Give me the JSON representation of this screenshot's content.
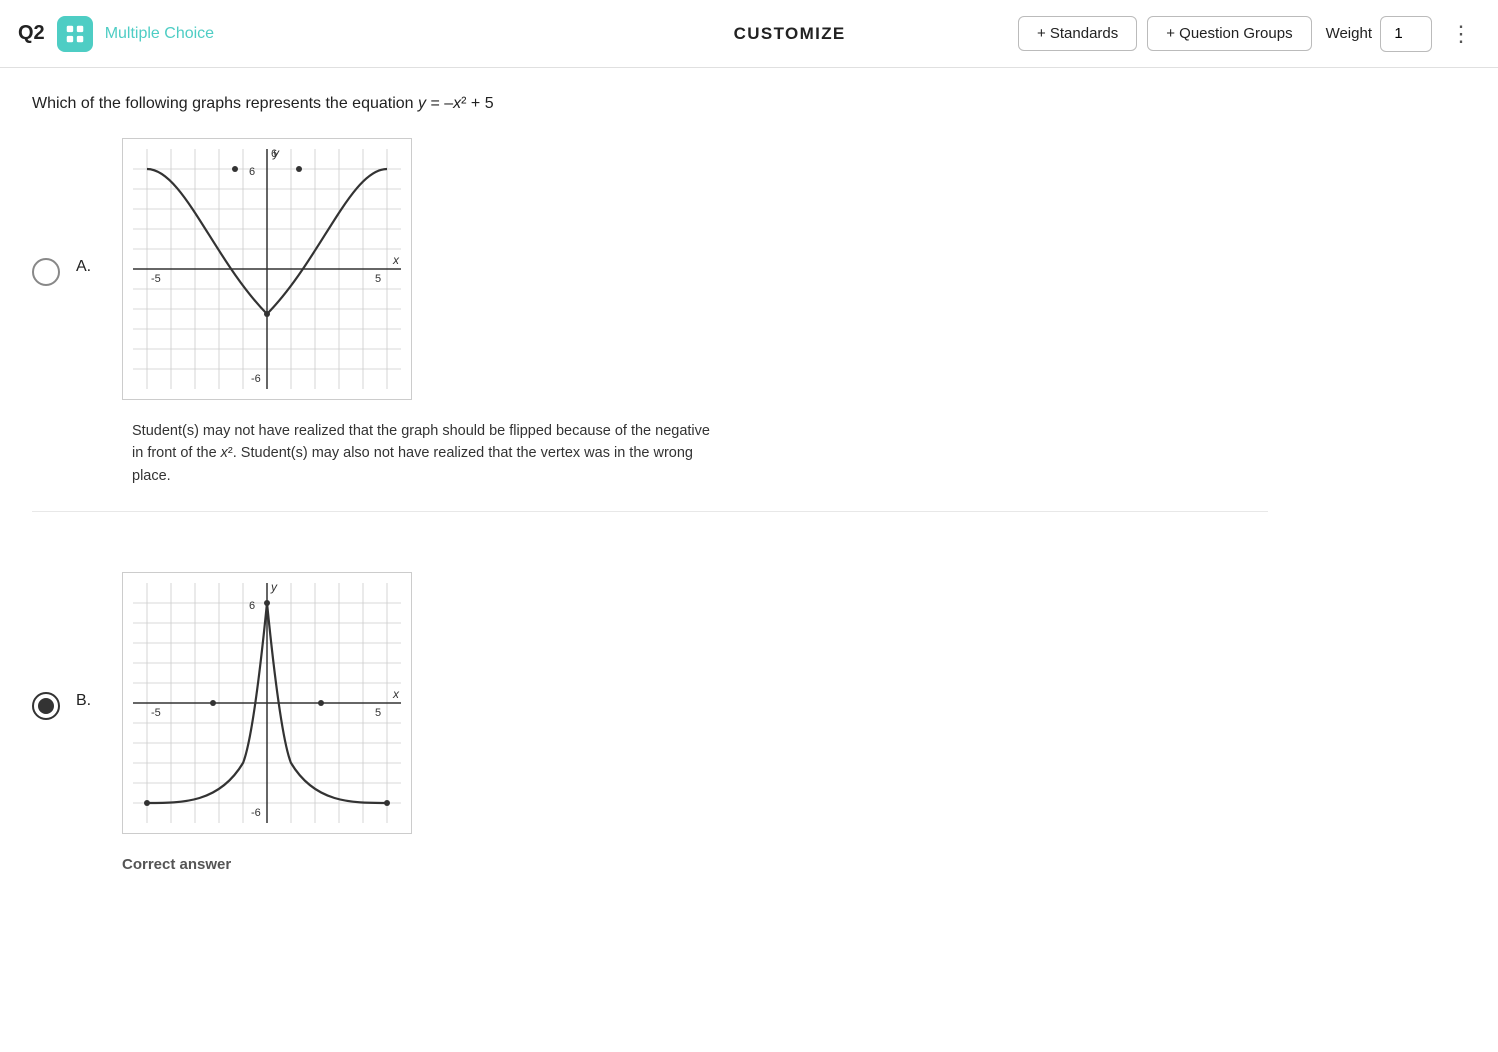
{
  "header": {
    "question_number": "Q2",
    "question_type": "Multiple Choice",
    "customize_label": "CUSTOMIZE",
    "standards_button": "+ Standards",
    "question_groups_button": "+ Question Groups",
    "weight_label": "Weight",
    "weight_value": "1"
  },
  "question": {
    "text": "Which of the following graphs represents the equation y = –x² + 5"
  },
  "answers": [
    {
      "id": "A",
      "label": "A.",
      "selected": false,
      "graph_type": "upward_parabola",
      "explanation": "Student(s) may not have realized that the graph should be flipped because of the negative in front of the x². Student(s) may also not have realized that the vertex was in the wrong place."
    },
    {
      "id": "B",
      "label": "B.",
      "selected": true,
      "graph_type": "downward_parabola",
      "explanation": "",
      "correct_answer_label": "Correct answer"
    }
  ]
}
